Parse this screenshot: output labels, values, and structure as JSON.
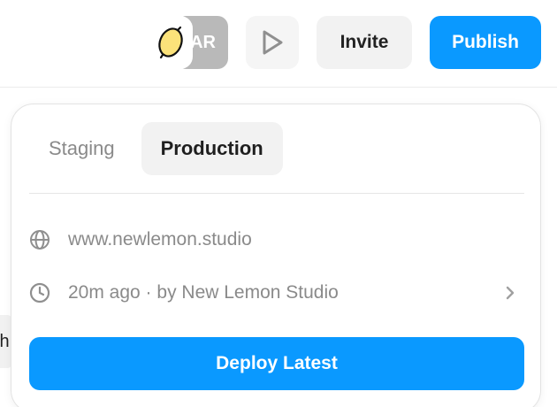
{
  "header": {
    "avatar_initials": "AR",
    "invite_label": "Invite",
    "publish_label": "Publish",
    "play_icon": "play-icon",
    "lemon_icon": "lemon-icon"
  },
  "background": {
    "peek_text": "th"
  },
  "publish_panel": {
    "tabs": [
      {
        "label": "Staging",
        "active": false
      },
      {
        "label": "Production",
        "active": true
      }
    ],
    "domain": "www.newlemon.studio",
    "last_deploy": "20m ago · by New Lemon Studio",
    "deploy_button_label": "Deploy Latest",
    "icons": {
      "domain": "globe-icon",
      "deploy": "clock-icon",
      "more": "chevron-right-icon"
    }
  },
  "colors": {
    "accent": "#0A99FF",
    "muted_text": "#8A8A8A",
    "avatar_gray": "#B9B9B9",
    "lemon_yellow": "#FBE27A"
  }
}
